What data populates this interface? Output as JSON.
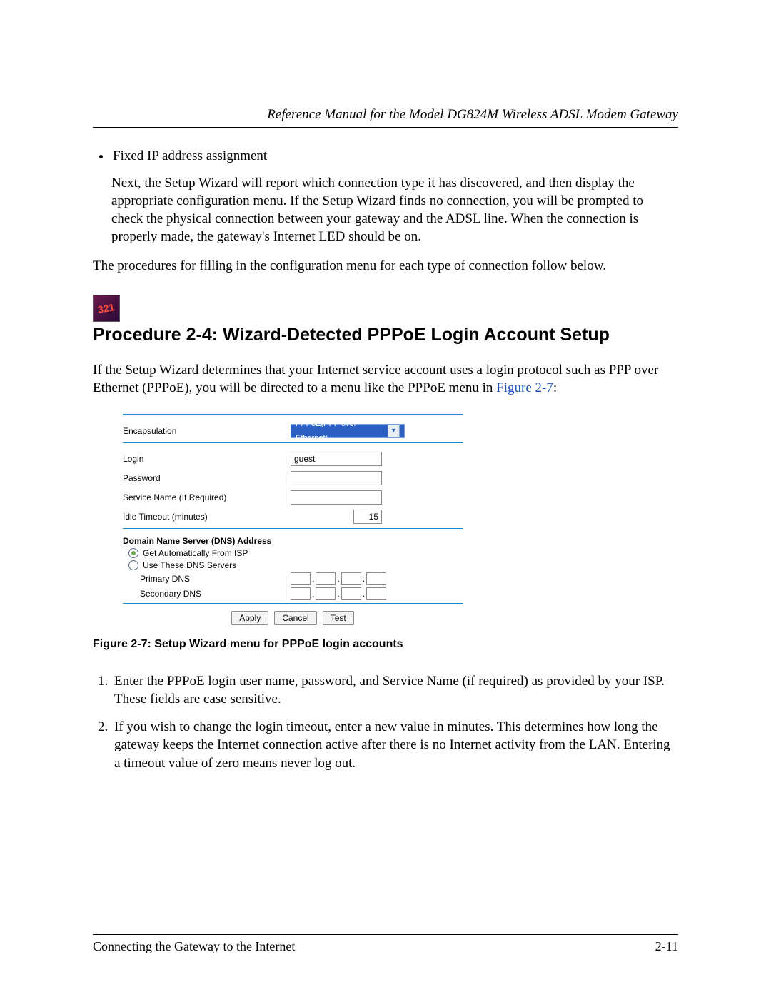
{
  "header": {
    "running_title": "Reference Manual for the Model DG824M Wireless ADSL Modem Gateway"
  },
  "top_list": {
    "item1": "Fixed IP address assignment"
  },
  "paras": {
    "p1": "Next, the Setup Wizard will report which connection type it has discovered, and then display the appropriate configuration menu. If the Setup Wizard finds no connection, you will be prompted to check the physical connection between your gateway and the ADSL line. When the connection is properly made, the gateway's Internet LED should be on.",
    "p2": "The procedures for filling in the configuration menu for each type of connection follow below.",
    "proc_icon": "321",
    "proc_title": "Procedure 2-4:  Wizard-Detected PPPoE Login Account Setup",
    "p3a": "If the Setup Wizard determines that your Internet service account uses a login protocol such as PPP over Ethernet (PPPoE), you will be directed to a menu like the PPPoE menu in ",
    "p3_link": "Figure 2-7",
    "p3b": ":"
  },
  "figure": {
    "labels": {
      "encapsulation": "Encapsulation",
      "login": "Login",
      "password": "Password",
      "service_name": "Service Name  (If Required)",
      "idle_timeout": "Idle Timeout (minutes)",
      "dns_header": "Domain Name Server (DNS) Address",
      "dns_auto": "Get Automatically From ISP",
      "dns_manual": "Use These DNS Servers",
      "primary_dns": "Primary DNS",
      "secondary_dns": "Secondary DNS"
    },
    "values": {
      "encapsulation_selected": "PPPoE(PPP over Ethernet)",
      "login": "guest",
      "password": "",
      "service_name": "",
      "idle_timeout": "15",
      "dns_mode": "auto"
    },
    "buttons": {
      "apply": "Apply",
      "cancel": "Cancel",
      "test": "Test"
    },
    "caption": "Figure 2-7: Setup Wizard menu for PPPoE login accounts"
  },
  "steps": {
    "s1": "Enter the PPPoE login user name, password, and Service Name (if required) as provided by your ISP. These fields are case sensitive.",
    "s2": "If you wish to change the login timeout, enter a new value in minutes. This determines how long the gateway keeps the Internet connection active after there is no Internet activity from the LAN. Entering a timeout value of zero means never log out."
  },
  "footer": {
    "section": "Connecting the Gateway to the Internet",
    "page": "2-11"
  }
}
